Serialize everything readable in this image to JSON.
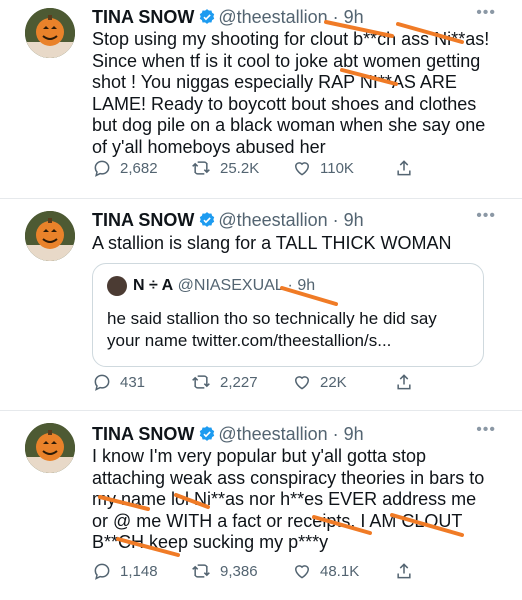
{
  "tweets": [
    {
      "name": "TINA SNOW",
      "handle": "@theestallion · 9h",
      "text": "Stop using my shooting for clout b**ch ass Ni**as! Since when tf is it cool to joke abt women getting shot ! You niggas especially RAP NI**AS ARE LAME! Ready to boycott bout shoes and clothes but dog pile on a black woman when she say one of y'all homeboys abused her",
      "replies": "2,682",
      "retweets": "25.2K",
      "likes": "110K"
    },
    {
      "name": "TINA SNOW",
      "handle": "@theestallion · 9h",
      "text": "A stallion is slang for a TALL THICK WOMAN",
      "quote": {
        "name": "N ÷ A",
        "handle": "@NIASEXUAL · 9h",
        "text": "he said stallion tho so technically he did say your name twitter.com/theestallion/s..."
      },
      "replies": "431",
      "retweets": "2,227",
      "likes": "22K"
    },
    {
      "name": "TINA SNOW",
      "handle": "@theestallion · 9h",
      "text": "I know I'm very popular but y'all gotta stop attaching weak ass conspiracy theories in bars to my name lol Ni**as nor h**es EVER address me or @ me WITH a fact or receipts. I AM CLOUT B**CH keep sucking my p***y",
      "replies": "1,148",
      "retweets": "9,386",
      "likes": "48.1K"
    }
  ],
  "icons": {
    "verified": "verified-badge-icon",
    "more": "more-horizontal-icon",
    "reply": "reply-icon",
    "retweet": "retweet-icon",
    "like": "like-icon",
    "share": "share-icon"
  },
  "colors": {
    "verified": "#1d9bf0",
    "secondary_text": "#536471",
    "censor_mark": "#f07b26"
  }
}
